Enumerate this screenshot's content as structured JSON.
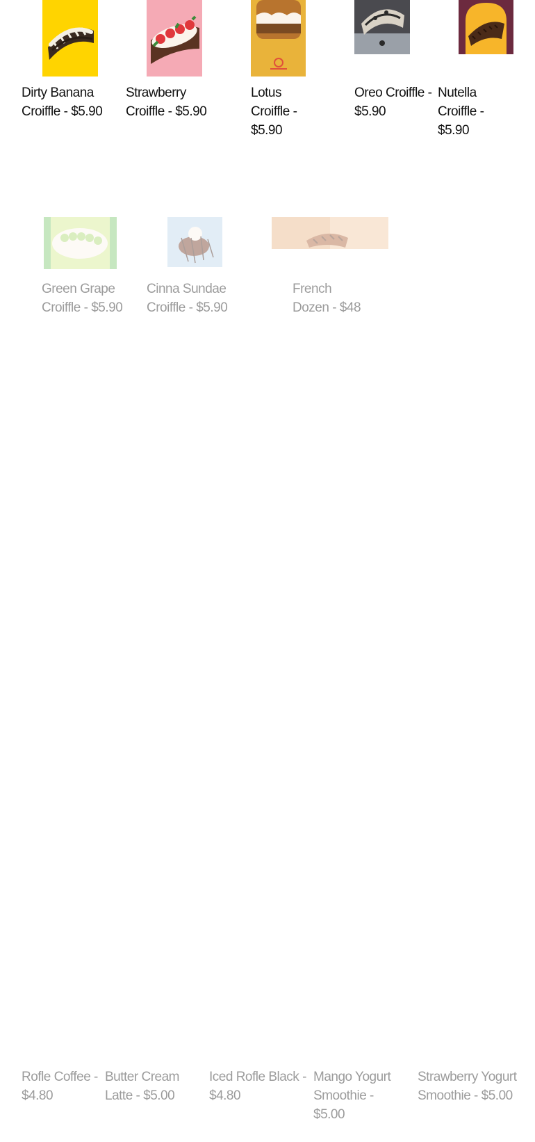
{
  "products": {
    "dirty_banana": {
      "label": "Dirty Banana Croiffle - $5.90",
      "image_color": "#ffd400"
    },
    "strawberry": {
      "label": "Strawberry Croiffle - $5.90",
      "image_color": "#f5aab5"
    },
    "lotus": {
      "label": "Lotus Croiffle - $5.90",
      "image_color": "#e9b33a"
    },
    "oreo": {
      "label": "Oreo Croiffle - $5.90",
      "image_color": "#4a4a4f"
    },
    "nutella": {
      "label": "Nutella Croiffle - $5.90",
      "image_color": "#6c2a3f"
    },
    "green_grape": {
      "label": "Green Grape Croiffle - $5.90",
      "image_color": "#7ac86a"
    },
    "cinna_sundae": {
      "label": "Cinna Sundae Croiffle - $5.90",
      "image_color": "#bcd6ec"
    },
    "french_dozen": {
      "label": "French Dozen - $48",
      "image_color": "#e6a673"
    }
  },
  "drinks": {
    "rofle_coffee": {
      "label": "Rofle Coffee - $4.80"
    },
    "butter_cream_latte": {
      "label": "Butter Cream Latte - $5.00"
    },
    "iced_rofle_black": {
      "label": "Iced Rofle Black - $4.80"
    },
    "mango_yogurt_smoothie": {
      "label": "Mango Yogurt Smoothie - $5.00"
    },
    "strawberry_yogurt_smoothie": {
      "label": "Strawberry Yogurt Smoothie - $5.00"
    }
  }
}
